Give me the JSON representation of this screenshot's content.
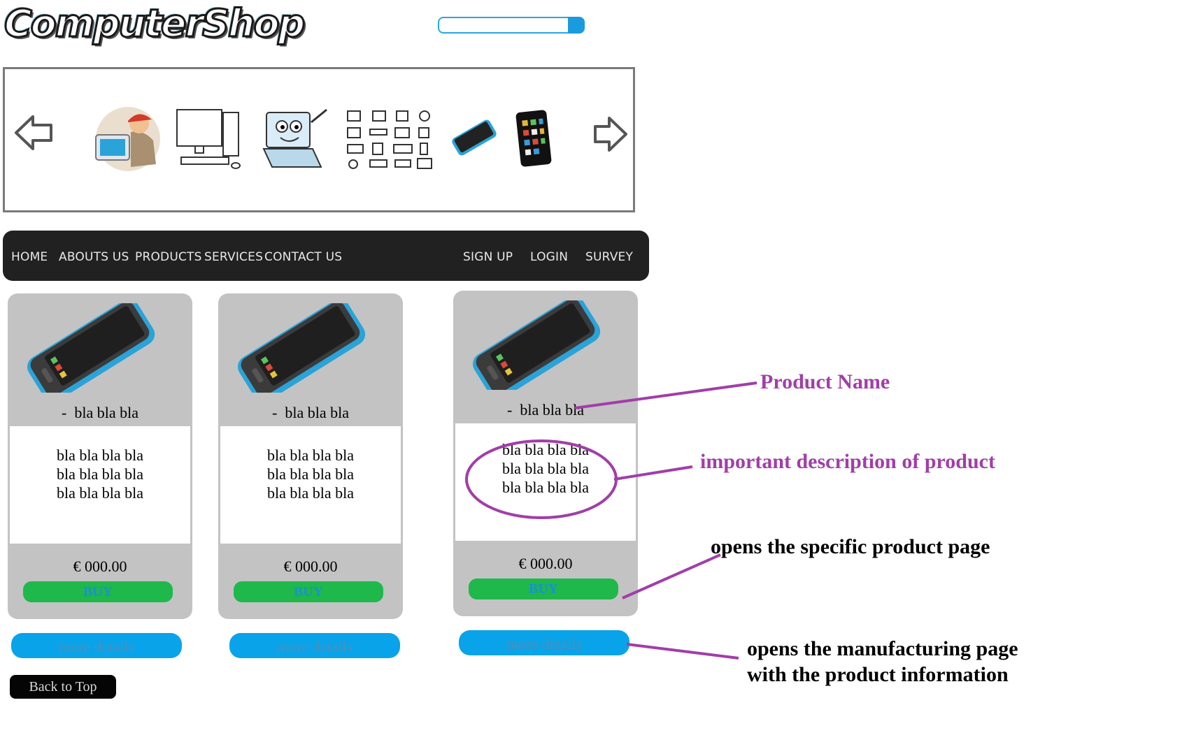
{
  "header": {
    "logo_text": "ComputerShop",
    "search": {
      "placeholder": ""
    }
  },
  "carousel": {
    "prev_icon": "arrow-left-icon",
    "next_icon": "arrow-right-icon",
    "images": [
      "technician-image",
      "desktop-computer-image",
      "laptop-cartoon-image",
      "hardware-icons-image",
      "smartphone-image",
      "tablet-image"
    ]
  },
  "nav": {
    "left": [
      "HOME",
      "ABOUTS US",
      "PRODUCTS",
      "SERVICES",
      "CONTACT US"
    ],
    "right": [
      "SIGN UP",
      "LOGIN",
      "SURVEY"
    ]
  },
  "products": [
    {
      "bullet": "-",
      "name": "bla bla bla",
      "desc": [
        "bla bla bla bla",
        "bla bla bla bla",
        "bla bla bla bla"
      ],
      "price": "€ 000.00",
      "buy": "BUY",
      "more": "more details"
    },
    {
      "bullet": "-",
      "name": "bla bla bla",
      "desc": [
        "bla bla bla bla",
        "bla bla bla bla",
        "bla bla bla bla"
      ],
      "price": "€ 000.00",
      "buy": "BUY",
      "more": "more details"
    },
    {
      "bullet": "-",
      "name": "bla bla bla",
      "desc": [
        "bla bla bla bla",
        "bla bla bla bla",
        "bla bla bla bla"
      ],
      "price": "€ 000.00",
      "buy": "BUY",
      "more": "more details"
    }
  ],
  "back_to_top": "Back to Top",
  "annotations": {
    "product_name": "Product Name",
    "description": "important description of product",
    "buy_note": "opens the specific product page",
    "more_note_1": "opens the manufacturing page",
    "more_note_2": "with the product information",
    "purple": "#a13ea8"
  }
}
